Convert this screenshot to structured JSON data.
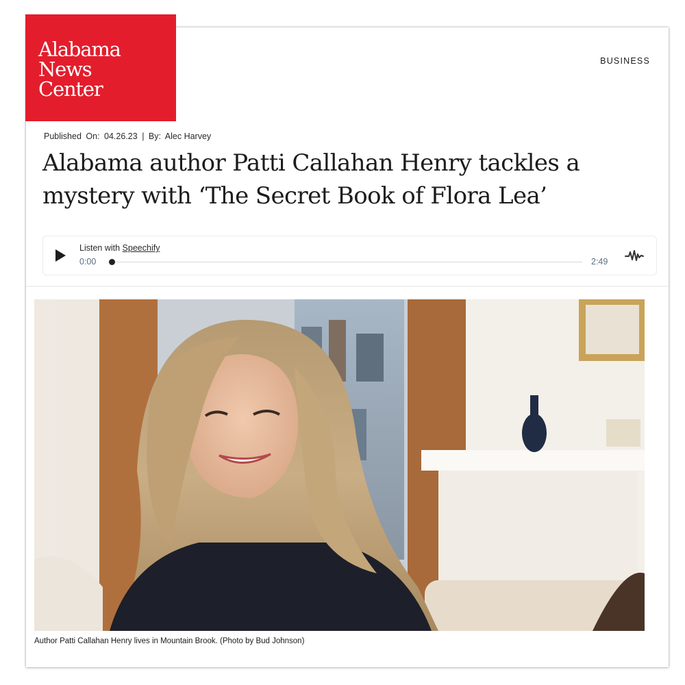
{
  "brand": {
    "logo_lines": [
      "Alabama",
      "News",
      "Center"
    ],
    "logo_color": "#e41d2c"
  },
  "header": {
    "section": "BUSINESS"
  },
  "article": {
    "published_label": "Published",
    "on_label": "On:",
    "date": "04.26.23",
    "separator": "|",
    "by_label": "By:",
    "author": "Alec Harvey",
    "headline": "Alabama author Patti Callahan Henry tackles a mystery with ‘The Secret Book of Flora Lea’"
  },
  "audio_player": {
    "listen_prefix": "Listen with",
    "provider": "Speechify",
    "current_time": "0:00",
    "duration": "2:49",
    "progress": 0,
    "play_icon": "play-icon",
    "brand_icon": "speechify-waveform-icon"
  },
  "photo": {
    "caption": "Author Patti Callahan Henry lives in Mountain Brook. (Photo by Bud Johnson)"
  }
}
